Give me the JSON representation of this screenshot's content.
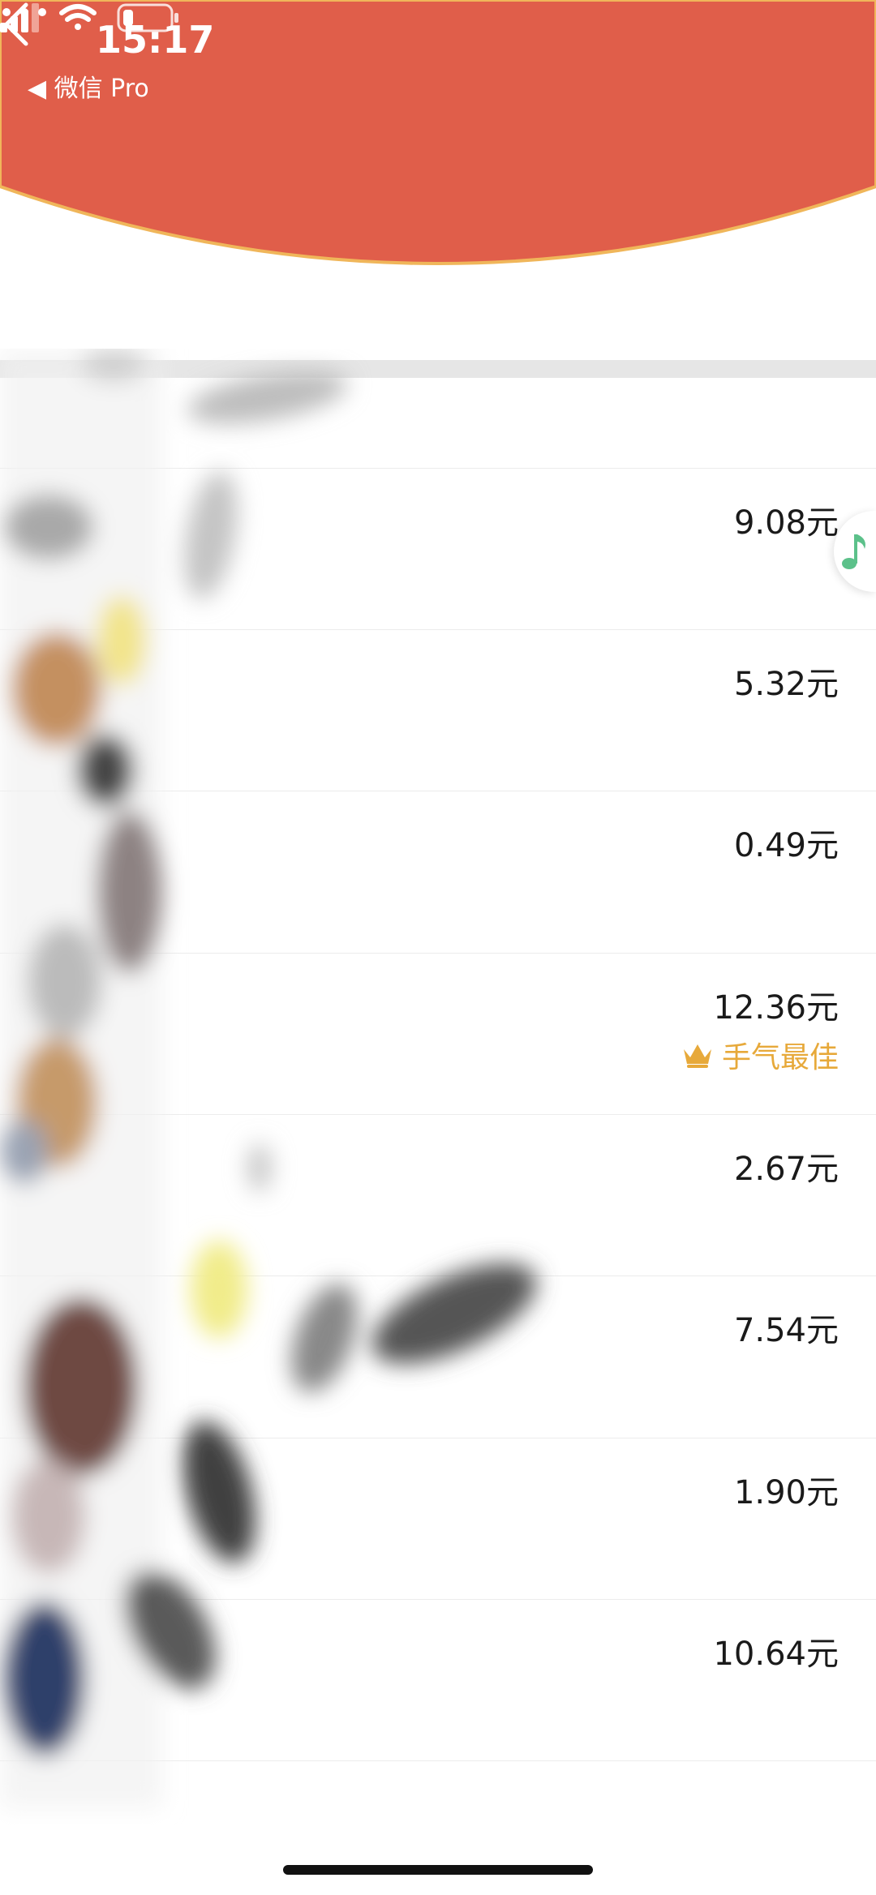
{
  "status_bar": {
    "time": "15:17",
    "back_app": "◀ 微信 Pro"
  },
  "colors": {
    "header_red": "#E05E4A",
    "header_gold_edge": "#F0B65A",
    "best_gold": "#E7A93A",
    "music_green": "#5CC18A"
  },
  "records": [
    {
      "amount": "9.08元"
    },
    {
      "amount": "5.32元"
    },
    {
      "amount": "0.49元"
    },
    {
      "amount": "12.36元",
      "badge": "手气最佳"
    },
    {
      "amount": "2.67元"
    },
    {
      "amount": "7.54元"
    },
    {
      "amount": "1.90元"
    },
    {
      "amount": "10.64元"
    }
  ]
}
